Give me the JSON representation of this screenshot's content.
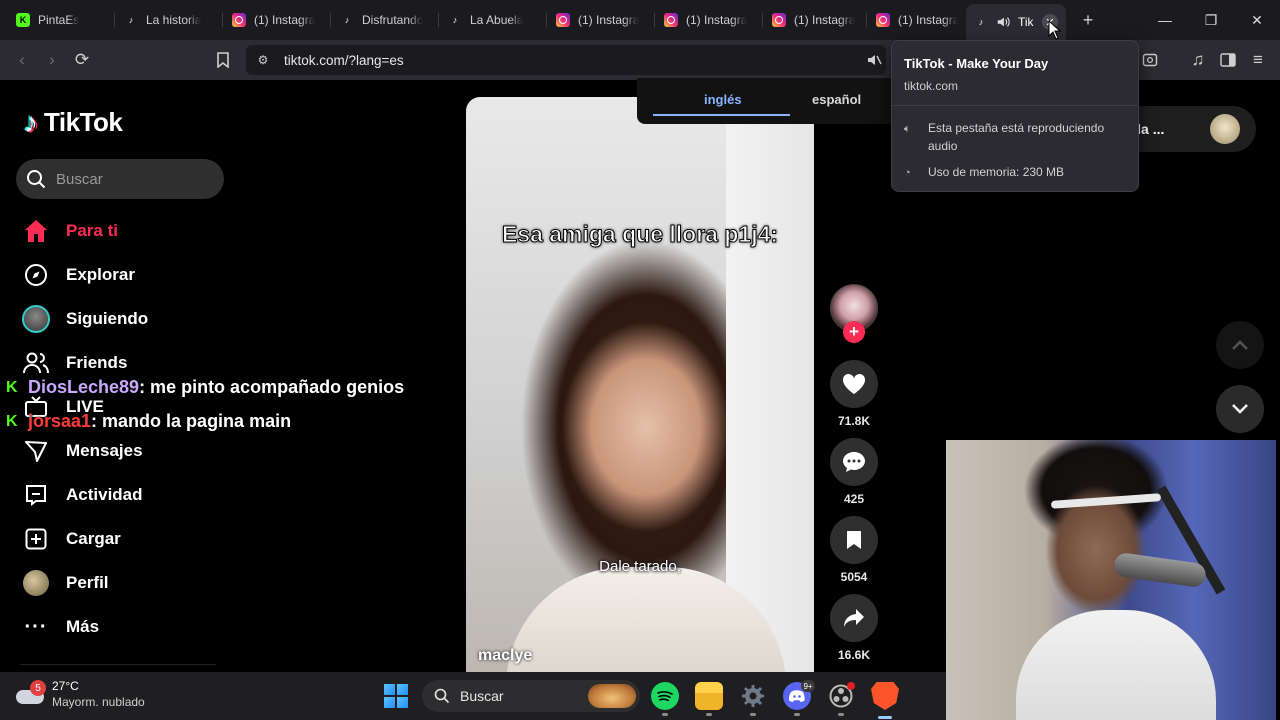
{
  "colors": {
    "accent": "#fe2c55",
    "kick_green": "#53fc18",
    "link_blue": "#8ab4ff",
    "chat_user_purple": "#c9a7ff",
    "chat_user_red": "#ff3b3b"
  },
  "tabs": [
    {
      "title": "PintaEs",
      "icon": "kick-icon"
    },
    {
      "title": "La historia",
      "icon": "tiktok-icon"
    },
    {
      "title": "(1) Instagra",
      "icon": "instagram-icon"
    },
    {
      "title": "Disfrutando",
      "icon": "tiktok-icon"
    },
    {
      "title": "La Abuela",
      "icon": "tiktok-icon"
    },
    {
      "title": "(1) Instagra",
      "icon": "instagram-icon"
    },
    {
      "title": "(1) Instagra",
      "icon": "instagram-icon"
    },
    {
      "title": "(1) Instagra",
      "icon": "instagram-icon"
    },
    {
      "title": "(1) Instagra",
      "icon": "instagram-icon"
    },
    {
      "title": "Tik",
      "icon": "tiktok-icon",
      "active": true,
      "audio": true
    }
  ],
  "address_bar": {
    "url": "tiktok.com/?lang=es"
  },
  "tab_hover_card": {
    "title": "TikTok - Make Your Day",
    "domain": "tiktok.com",
    "audio_line1": "Esta pestaña está reproduciendo",
    "audio_line2": "audio",
    "memory": "Uso de memoria: 230 MB"
  },
  "language_popup": {
    "tabs": [
      "inglés",
      "español"
    ],
    "selected": "inglés"
  },
  "header_chip": {
    "text": "er la ..."
  },
  "tiktok": {
    "logo_text": "TikTok",
    "search_placeholder": "Buscar",
    "nav": [
      {
        "label": "Para ti",
        "icon": "home-icon",
        "active": true
      },
      {
        "label": "Explorar",
        "icon": "compass-icon"
      },
      {
        "label": "Siguiendo",
        "icon": "following-avatar"
      },
      {
        "label": "Friends",
        "icon": "friends-icon"
      },
      {
        "label": "LIVE",
        "icon": "live-icon"
      },
      {
        "label": "Mensajes",
        "icon": "send-icon"
      },
      {
        "label": "Actividad",
        "icon": "activity-icon"
      },
      {
        "label": "Cargar",
        "icon": "upload-icon"
      },
      {
        "label": "Perfil",
        "icon": "profile-avatar"
      },
      {
        "label": "Más",
        "icon": "more-icon"
      }
    ]
  },
  "chat": [
    {
      "user": "DiosLeche89",
      "message": " : me pinto acompañado genios"
    },
    {
      "user": "jorsaa1",
      "message": " : mando la pagina main"
    }
  ],
  "video": {
    "caption_top": "Esa amiga que llora p1j4:",
    "subtitle": "Dale tarado,",
    "author": "maclye"
  },
  "actions": {
    "likes": "71.8K",
    "comments": "425",
    "saves": "5054",
    "shares": "16.6K"
  },
  "taskbar": {
    "weather_badge": "5",
    "temperature": "27°C",
    "condition": "Mayorm. nublado",
    "search_label": "Buscar",
    "discord_badge": "9+"
  }
}
